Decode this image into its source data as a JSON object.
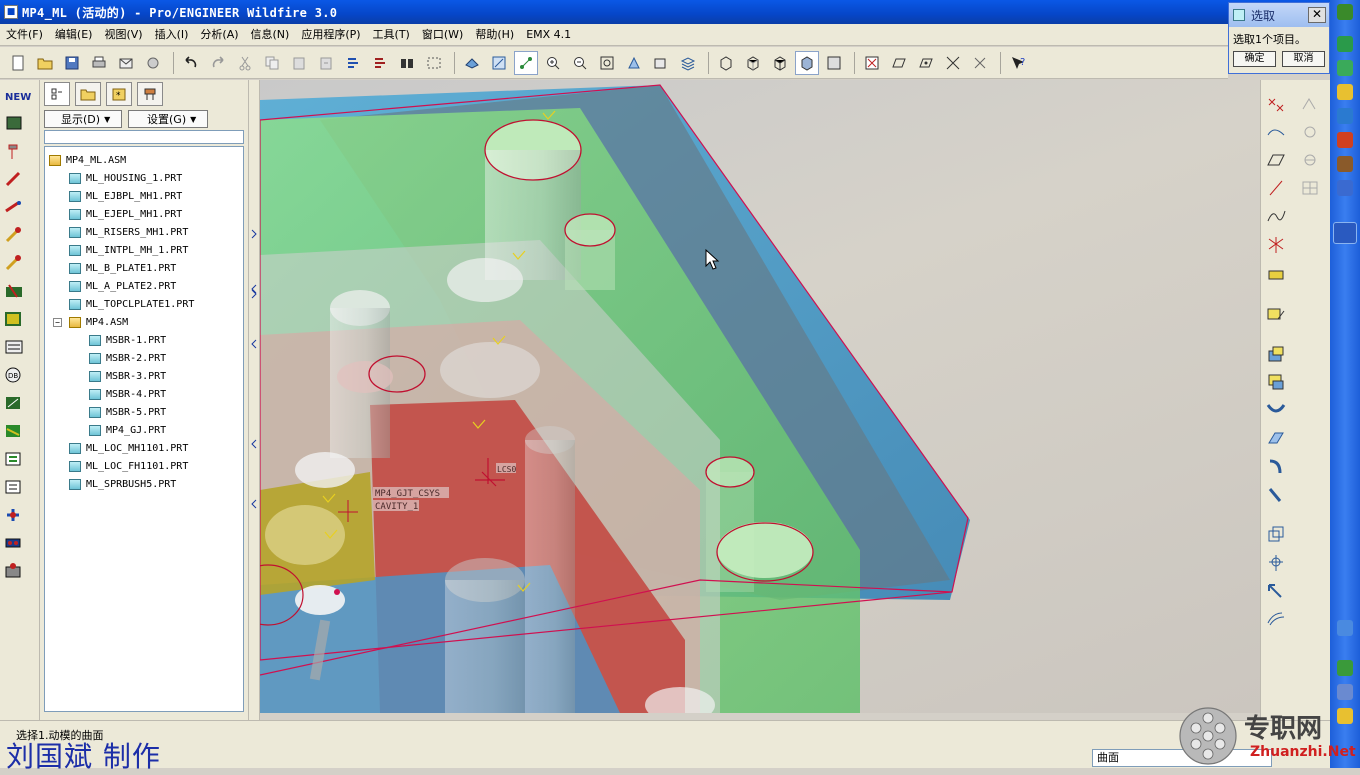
{
  "window": {
    "title": "MP4_ML (活动的) - Pro/ENGINEER Wildfire 3.0"
  },
  "menu": [
    "文件(F)",
    "编辑(E)",
    "视图(V)",
    "插入(I)",
    "分析(A)",
    "信息(N)",
    "应用程序(P)",
    "工具(T)",
    "窗口(W)",
    "帮助(H)",
    "EMX 4.1"
  ],
  "model_tree": {
    "show_label": "显示(D)",
    "settings_label": "设置(G)",
    "root": "MP4_ML.ASM",
    "items": [
      {
        "label": "ML_HOUSING_1.PRT",
        "type": "part",
        "level": 1
      },
      {
        "label": "ML_EJBPL_MH1.PRT",
        "type": "part",
        "level": 1
      },
      {
        "label": "ML_EJEPL_MH1.PRT",
        "type": "part",
        "level": 1
      },
      {
        "label": "ML_RISERS_MH1.PRT",
        "type": "part",
        "level": 1
      },
      {
        "label": "ML_INTPL_MH_1.PRT",
        "type": "part",
        "level": 1
      },
      {
        "label": "ML_B_PLATE1.PRT",
        "type": "part",
        "level": 1
      },
      {
        "label": "ML_A_PLATE2.PRT",
        "type": "part",
        "level": 1
      },
      {
        "label": "ML_TOPCLPLATE1.PRT",
        "type": "part",
        "level": 1
      },
      {
        "label": "MP4.ASM",
        "type": "asm",
        "level": 1,
        "expanded": true
      },
      {
        "label": "MSBR-1.PRT",
        "type": "part",
        "level": 2
      },
      {
        "label": "MSBR-2.PRT",
        "type": "part",
        "level": 2
      },
      {
        "label": "MSBR-3.PRT",
        "type": "part",
        "level": 2
      },
      {
        "label": "MSBR-4.PRT",
        "type": "part",
        "level": 2
      },
      {
        "label": "MSBR-5.PRT",
        "type": "part",
        "level": 2
      },
      {
        "label": "MP4_GJ.PRT",
        "type": "part",
        "level": 2
      },
      {
        "label": "ML_LOC_MH1101.PRT",
        "type": "part",
        "level": 1
      },
      {
        "label": "ML_LOC_FH1101.PRT",
        "type": "part",
        "level": 1
      },
      {
        "label": "ML_SPRBUSH5.PRT",
        "type": "part",
        "level": 1
      }
    ]
  },
  "viewport": {
    "csys_label_1": "MP4_GJT_CSYS",
    "csys_label_2": "CAVITY_1",
    "csys_label_3": "LCS0"
  },
  "select_dialog": {
    "title": "选取",
    "message": "选取1个项目。",
    "ok": "确定",
    "cancel": "取消"
  },
  "status": {
    "message": "选择1.动模的曲面",
    "author": "刘国斌  制作",
    "filter": "曲面"
  },
  "watermark": {
    "text_cn": "专职网",
    "text_en": "Zhuanzhi.Net"
  },
  "colors": {
    "title_blue": "#0646c8",
    "green_plate": "#8fd98a",
    "blue_plate": "#5aa0c8",
    "red_plate": "#c8504a",
    "selection": "#d01040"
  }
}
